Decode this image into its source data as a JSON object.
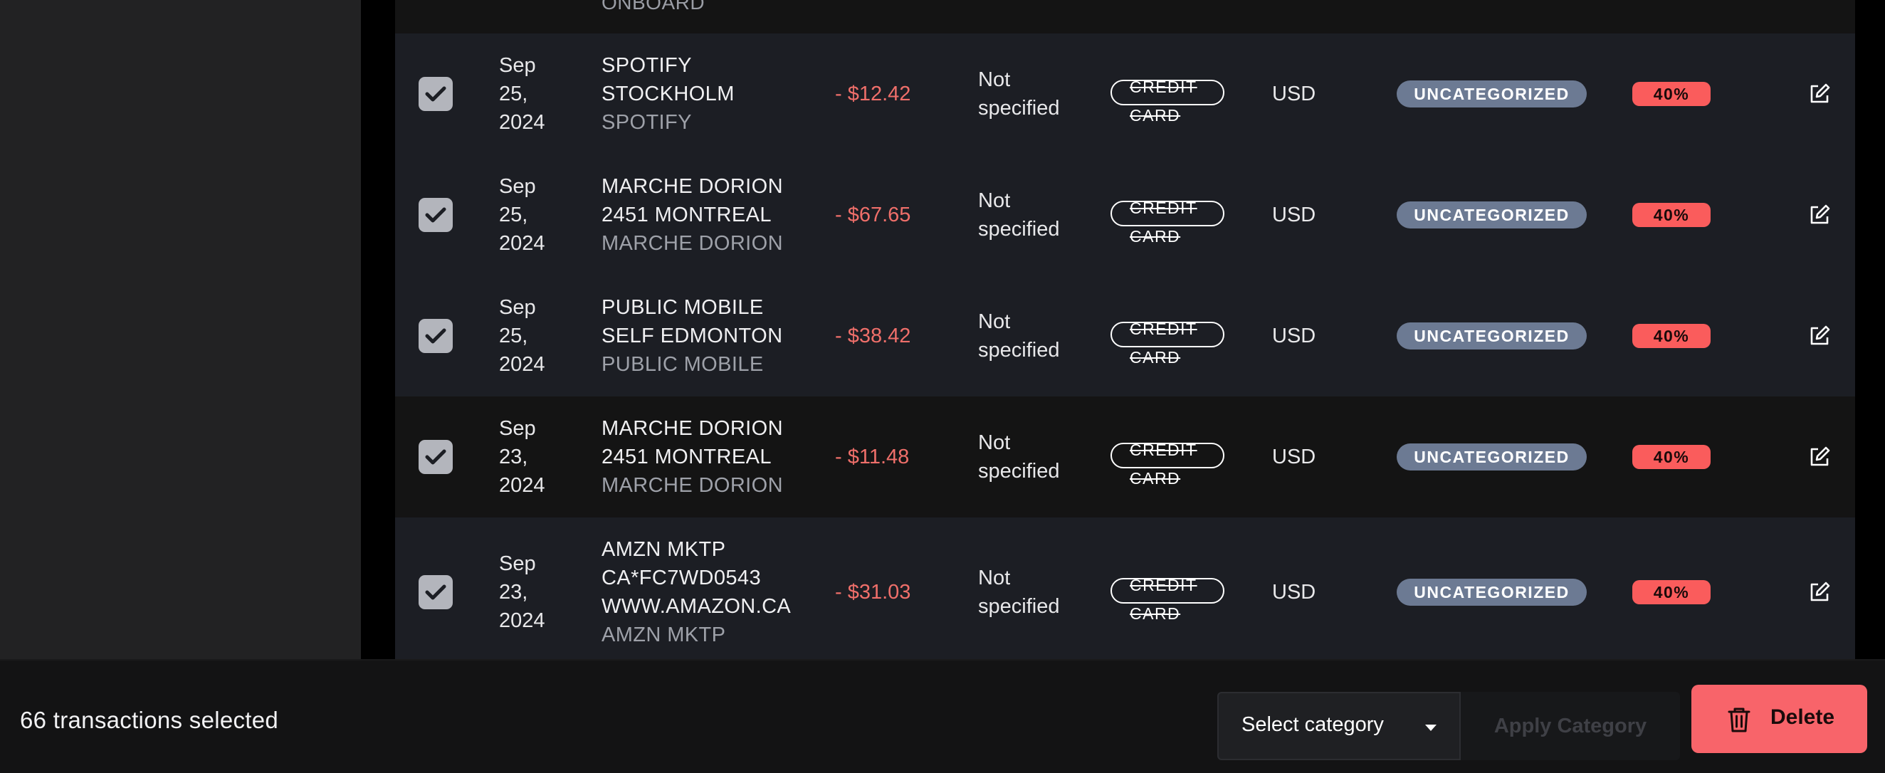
{
  "table": {
    "partial_row_merchant": "ONBOARD",
    "rows": [
      {
        "date_lines": [
          "Sep",
          "25,",
          "2024"
        ],
        "merchant_lines": [
          "SPOTIFY",
          "STOCKHOLM"
        ],
        "merchant_sub": "SPOTIFY",
        "amount": "- $12.42",
        "status_lines": [
          "Not",
          "specified"
        ],
        "method_lines": [
          "CREDIT",
          "CARD"
        ],
        "currency": "USD",
        "category": "UNCATEGORIZED",
        "percent": "40%",
        "checked": true
      },
      {
        "date_lines": [
          "Sep",
          "25,",
          "2024"
        ],
        "merchant_lines": [
          "MARCHE DORION",
          "2451 MONTREAL"
        ],
        "merchant_sub": "MARCHE DORION",
        "amount": "- $67.65",
        "status_lines": [
          "Not",
          "specified"
        ],
        "method_lines": [
          "CREDIT",
          "CARD"
        ],
        "currency": "USD",
        "category": "UNCATEGORIZED",
        "percent": "40%",
        "checked": true
      },
      {
        "date_lines": [
          "Sep",
          "25,",
          "2024"
        ],
        "merchant_lines": [
          "PUBLIC MOBILE",
          "SELF EDMONTON"
        ],
        "merchant_sub": "PUBLIC MOBILE",
        "amount": "- $38.42",
        "status_lines": [
          "Not",
          "specified"
        ],
        "method_lines": [
          "CREDIT",
          "CARD"
        ],
        "currency": "USD",
        "category": "UNCATEGORIZED",
        "percent": "40%",
        "checked": true
      },
      {
        "date_lines": [
          "Sep",
          "23,",
          "2024"
        ],
        "merchant_lines": [
          "MARCHE DORION",
          "2451 MONTREAL"
        ],
        "merchant_sub": "MARCHE DORION",
        "amount": "- $11.48",
        "status_lines": [
          "Not",
          "specified"
        ],
        "method_lines": [
          "CREDIT",
          "CARD"
        ],
        "currency": "USD",
        "category": "UNCATEGORIZED",
        "percent": "40%",
        "checked": true
      },
      {
        "date_lines": [
          "Sep",
          "23,",
          "2024"
        ],
        "merchant_lines": [
          "AMZN MKTP",
          "CA*FC7WD0543",
          "WWW.AMAZON.CA"
        ],
        "merchant_sub": "AMZN MKTP",
        "amount": "- $31.03",
        "status_lines": [
          "Not",
          "specified"
        ],
        "method_lines": [
          "CREDIT",
          "CARD"
        ],
        "currency": "USD",
        "category": "UNCATEGORIZED",
        "percent": "40%",
        "checked": true
      }
    ]
  },
  "bulk_bar": {
    "selected_text": "66 transactions selected",
    "select_placeholder": "Select category",
    "apply_label": "Apply Category",
    "delete_label": "Delete"
  },
  "icons": {
    "checkbox": "check-icon",
    "edit": "edit-icon",
    "delete": "trash-icon",
    "dropdown": "caret-down-icon"
  },
  "colors": {
    "amount_negative": "#ef6f6a",
    "category_badge": "#6c7a93",
    "percent_badge": "#fa5c5c",
    "delete_button": "#f8646a"
  }
}
